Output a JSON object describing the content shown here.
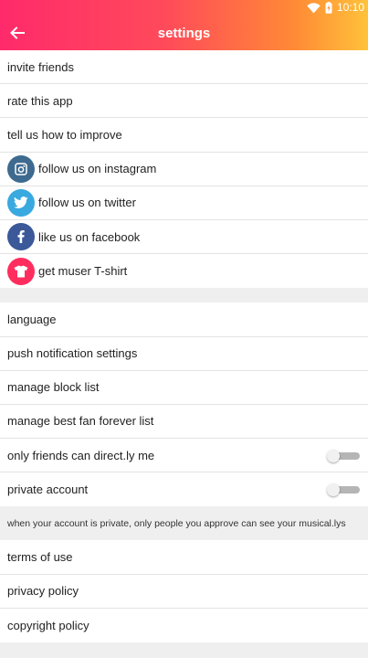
{
  "status_bar": {
    "time": "10:10"
  },
  "header": {
    "title": "settings"
  },
  "section1": [
    {
      "label": "invite friends"
    },
    {
      "label": "rate this app"
    },
    {
      "label": "tell us how to improve"
    },
    {
      "label": "follow us on instagram",
      "icon": "instagram-icon",
      "color": "#3e6a8f"
    },
    {
      "label": "follow us on twitter",
      "icon": "twitter-icon",
      "color": "#39a9e0"
    },
    {
      "label": "like us on facebook",
      "icon": "facebook-icon",
      "color": "#3b5998"
    },
    {
      "label": "get muser T-shirt",
      "icon": "tshirt-icon",
      "color": "#ff2d5e"
    }
  ],
  "section2": [
    {
      "label": "language"
    },
    {
      "label": "push notification settings"
    },
    {
      "label": "manage block list"
    },
    {
      "label": "manage best fan forever list"
    },
    {
      "label": "only friends can direct.ly me",
      "toggle": false
    },
    {
      "label": "private account",
      "toggle": false
    }
  ],
  "private_note": "when your account is private, only people you approve can see your musical.lys",
  "section3": [
    {
      "label": "terms of use"
    },
    {
      "label": "privacy policy"
    },
    {
      "label": "copyright policy"
    }
  ]
}
